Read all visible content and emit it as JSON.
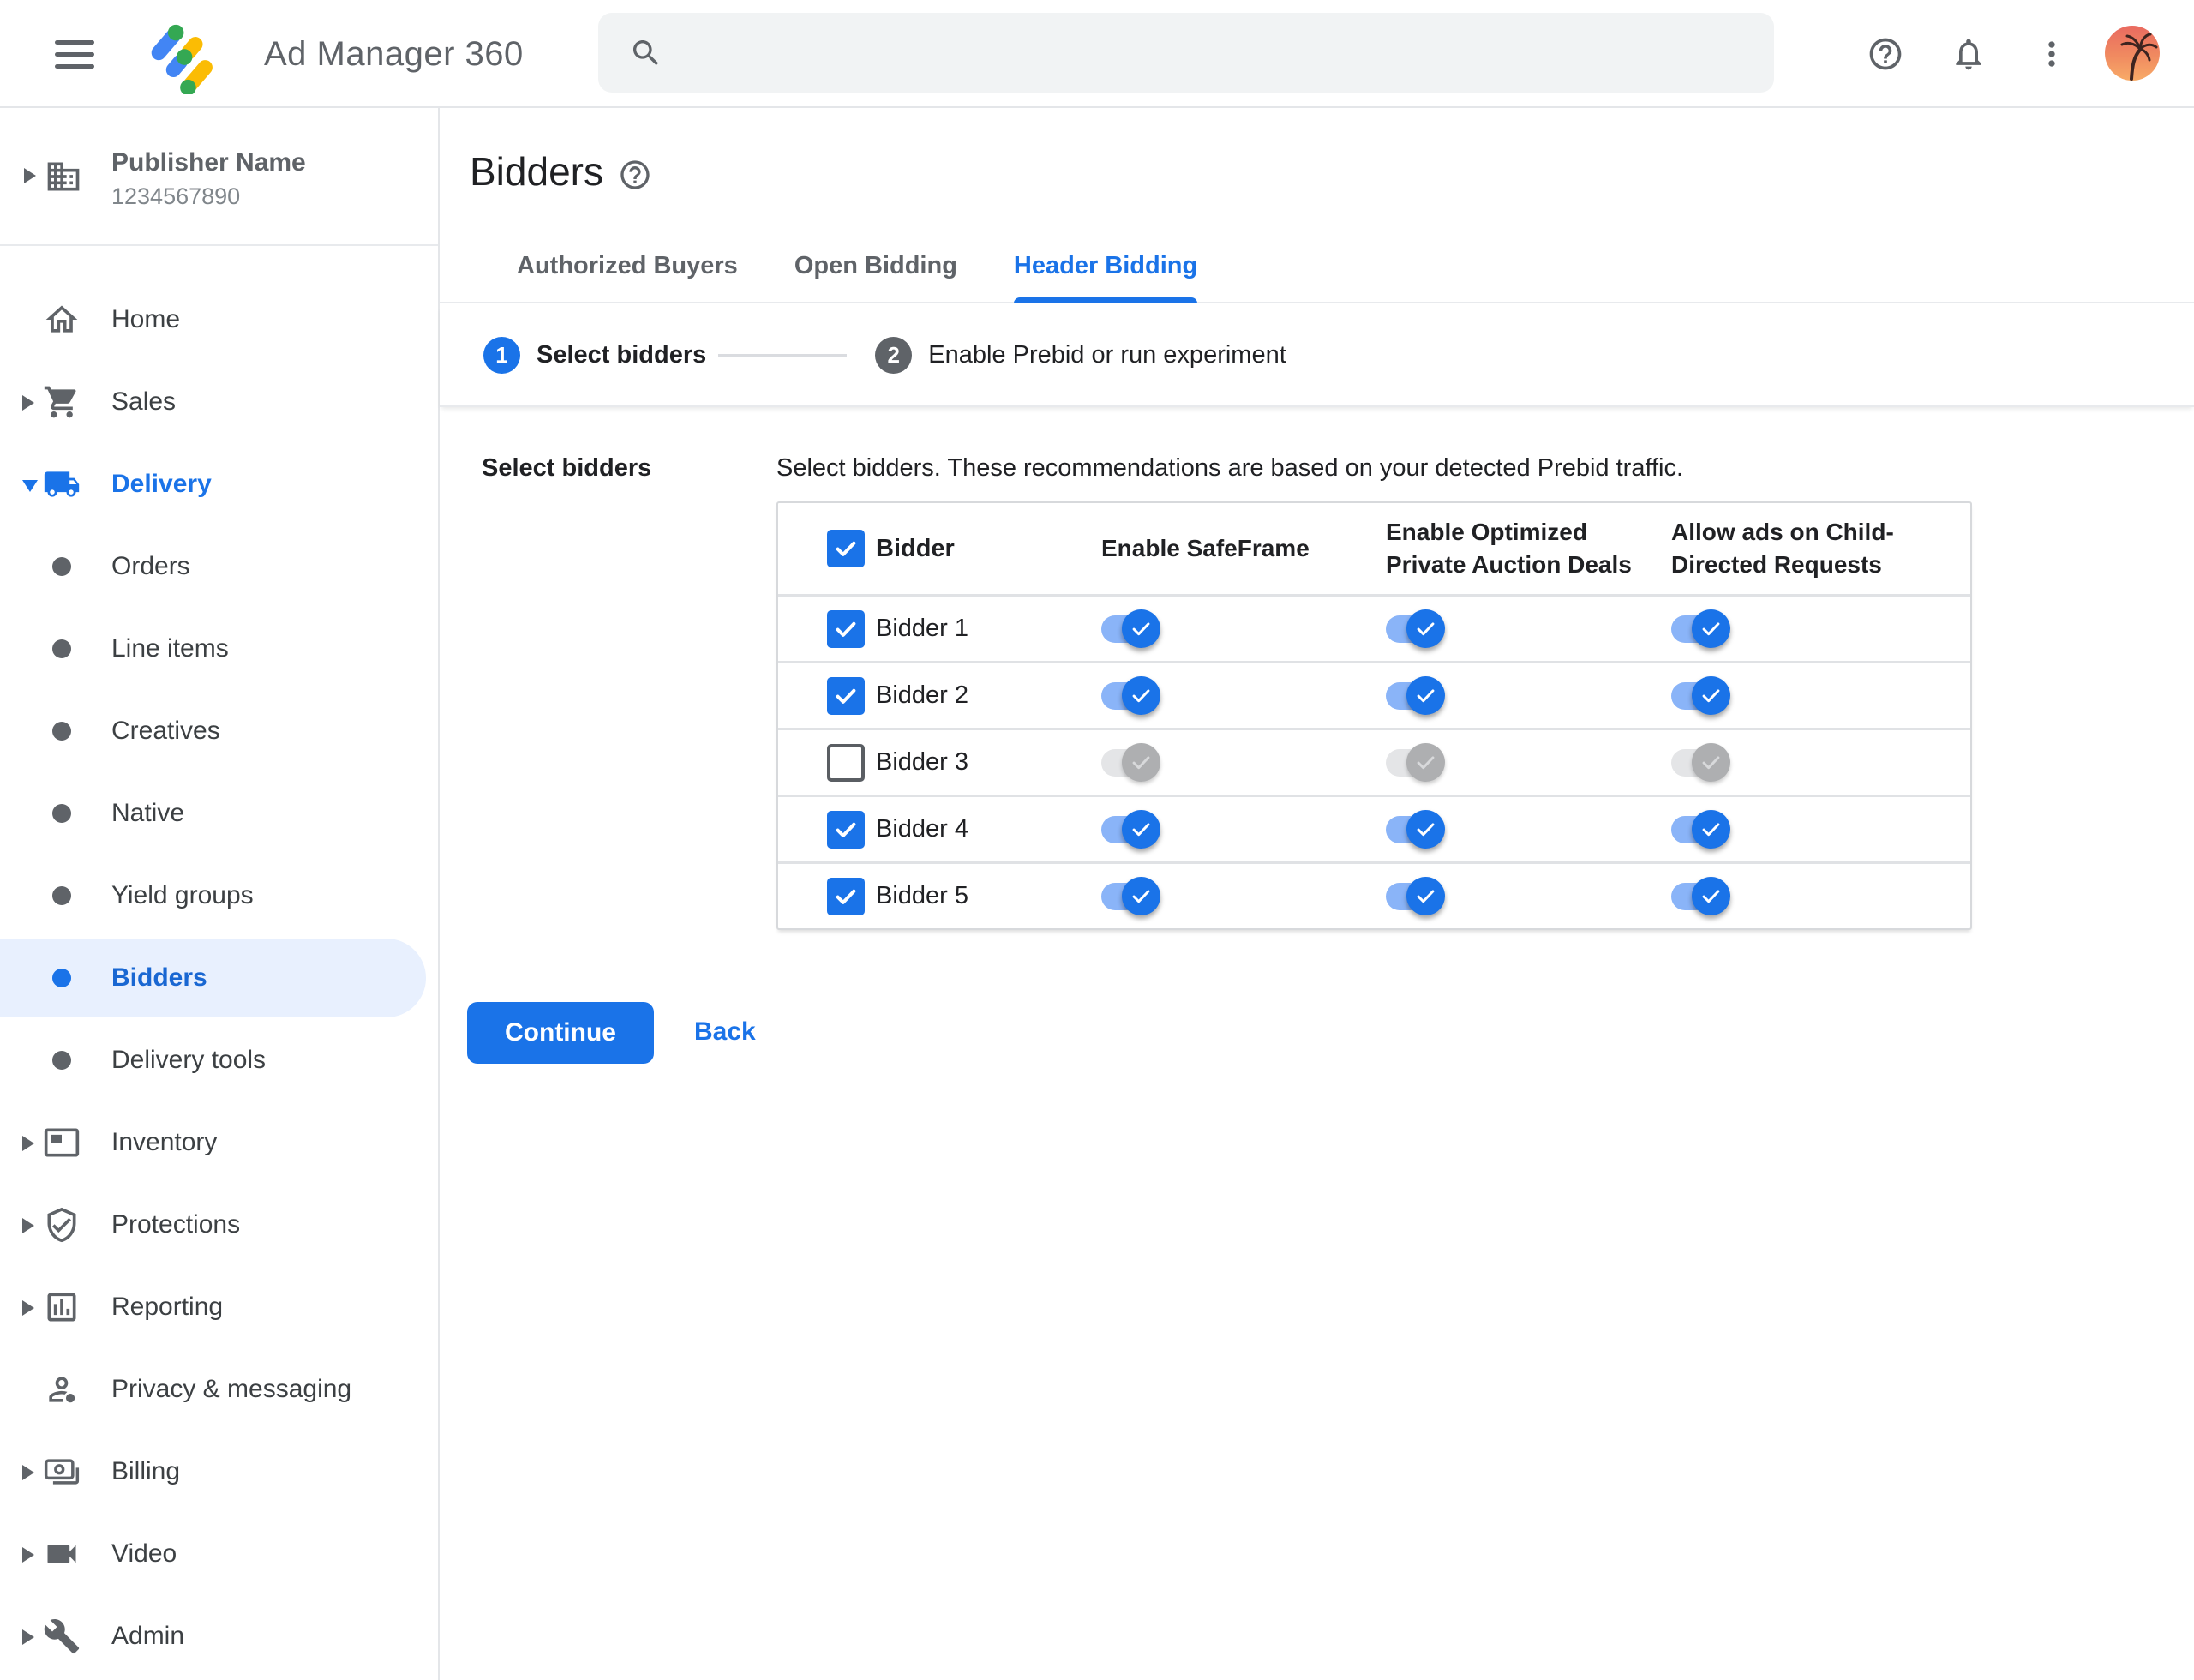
{
  "topbar": {
    "brand": "Ad Manager 360",
    "search_placeholder": ""
  },
  "sidebar": {
    "publisher": {
      "name": "Publisher Name",
      "id": "1234567890"
    },
    "items": [
      {
        "label": "Home"
      },
      {
        "label": "Sales"
      },
      {
        "label": "Delivery"
      },
      {
        "label": "Orders"
      },
      {
        "label": "Line items"
      },
      {
        "label": "Creatives"
      },
      {
        "label": "Native"
      },
      {
        "label": "Yield groups"
      },
      {
        "label": "Bidders"
      },
      {
        "label": "Delivery tools"
      },
      {
        "label": "Inventory"
      },
      {
        "label": "Protections"
      },
      {
        "label": "Reporting"
      },
      {
        "label": "Privacy & messaging"
      },
      {
        "label": "Billing"
      },
      {
        "label": "Video"
      },
      {
        "label": "Admin"
      }
    ]
  },
  "main": {
    "title": "Bidders",
    "tabs": [
      {
        "label": "Authorized Buyers"
      },
      {
        "label": "Open Bidding"
      },
      {
        "label": "Header Bidding"
      }
    ],
    "steps": [
      {
        "num": "1",
        "label": "Select bidders"
      },
      {
        "num": "2",
        "label": "Enable Prebid or run experiment"
      }
    ],
    "section_label": "Select bidders",
    "description": "Select bidders. These recommendations are based on your detected Prebid traffic.",
    "table": {
      "header_checked": true,
      "columns": [
        "Bidder",
        "Enable SafeFrame",
        "Enable Optimized Private Auction Deals",
        "Allow ads on Child-Directed Requests"
      ],
      "col2_line1": "Enable Optimized",
      "col2_line2": "Private Auction Deals",
      "col3_line1": "Allow ads on Child-",
      "col3_line2": "Directed Requests",
      "rows": [
        {
          "name": "Bidder 1",
          "checked": true,
          "safeframe": true,
          "optimized": true,
          "child_directed": true
        },
        {
          "name": "Bidder 2",
          "checked": true,
          "safeframe": true,
          "optimized": true,
          "child_directed": true
        },
        {
          "name": "Bidder 3",
          "checked": false,
          "safeframe": false,
          "optimized": false,
          "child_directed": false
        },
        {
          "name": "Bidder 4",
          "checked": true,
          "safeframe": true,
          "optimized": true,
          "child_directed": true
        },
        {
          "name": "Bidder 5",
          "checked": true,
          "safeframe": true,
          "optimized": true,
          "child_directed": true
        }
      ]
    },
    "continue_label": "Continue",
    "back_label": "Back"
  },
  "colors": {
    "accent_blue": "#1a73e8",
    "selected_pill": "#e8f0fe",
    "toggle_track_on": "#8ab4f8",
    "text_gray": "#5f6368"
  }
}
